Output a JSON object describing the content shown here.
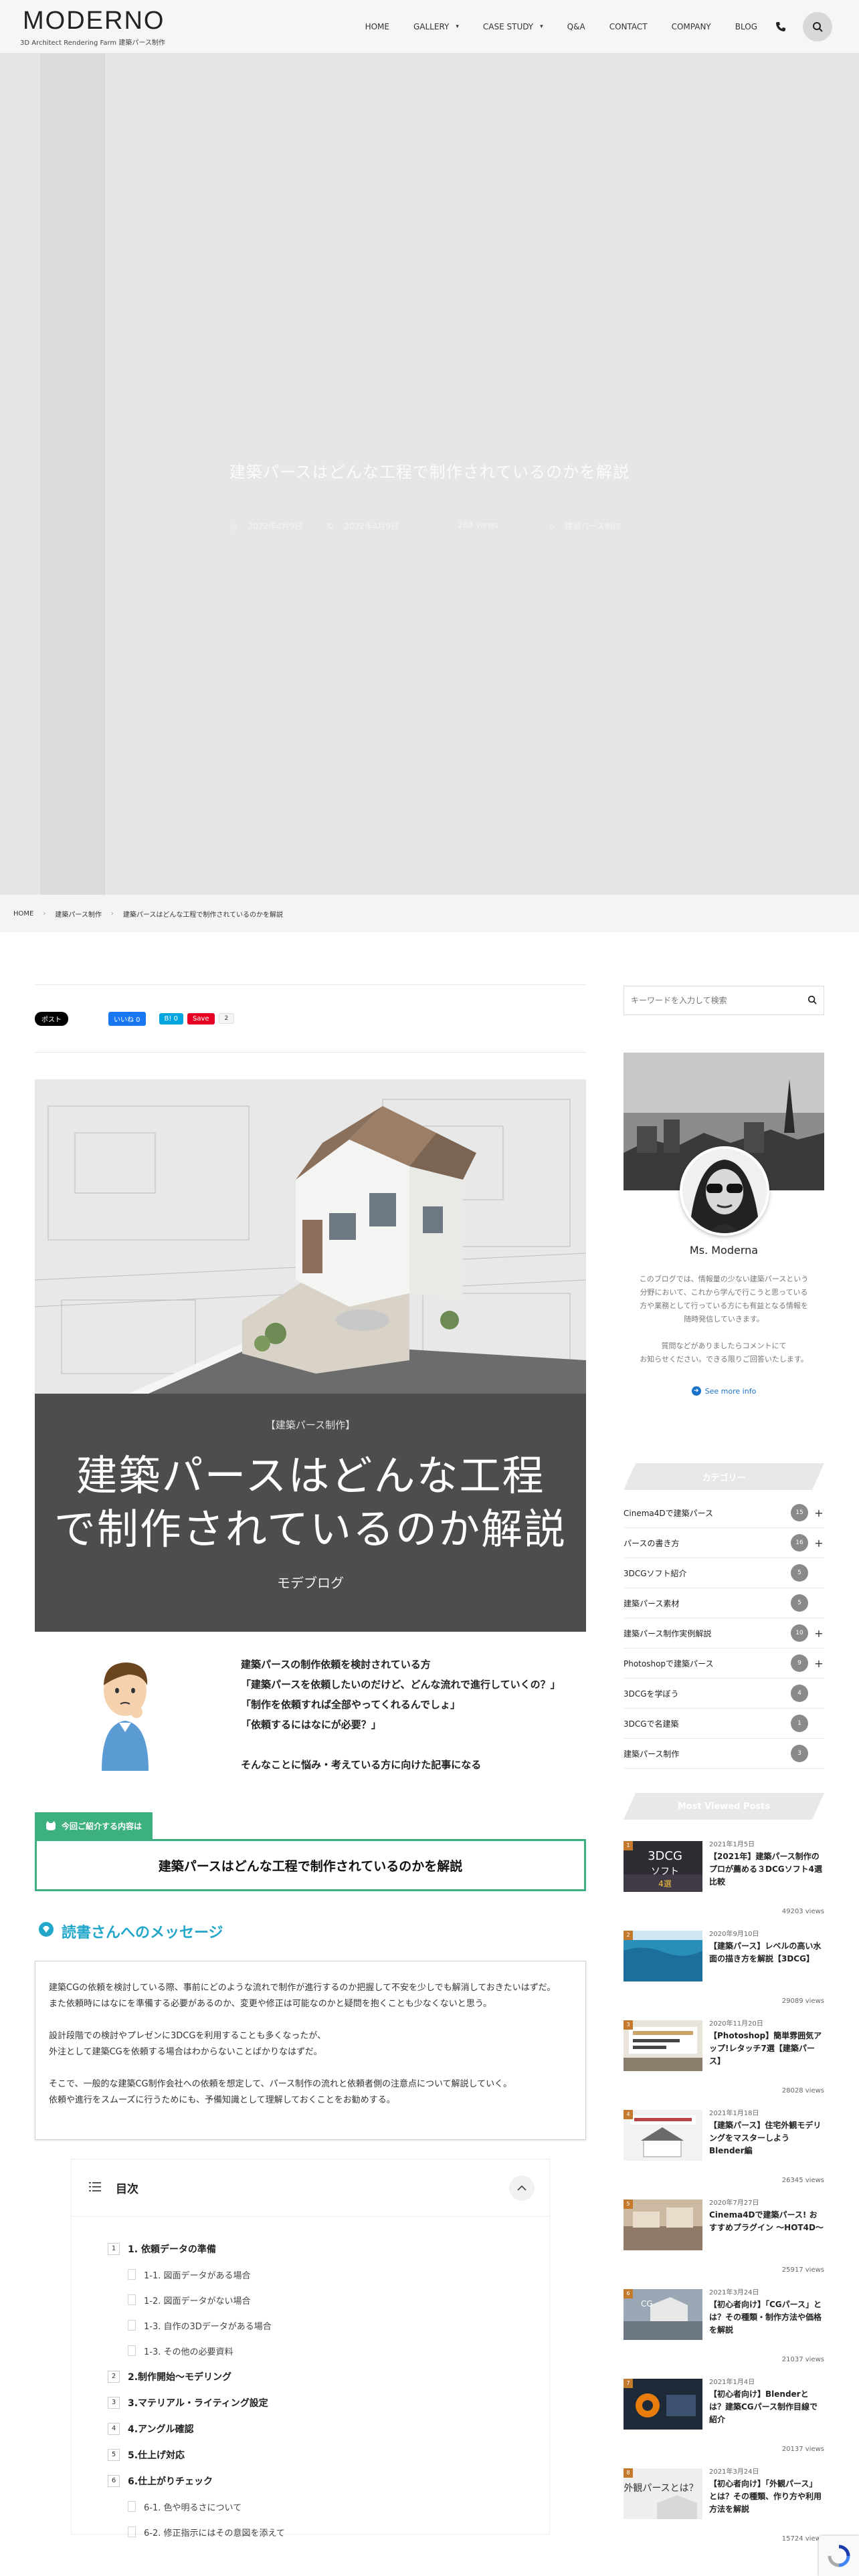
{
  "header": {
    "logo": "MODERNO",
    "logo_sub": "3D Architect Rendering Farm 建築パース制作",
    "nav": [
      {
        "label": "HOME",
        "caret": false
      },
      {
        "label": "GALLERY",
        "caret": true
      },
      {
        "label": "CASE STUDY",
        "caret": true
      },
      {
        "label": "Q&A",
        "caret": false
      },
      {
        "label": "CONTACT",
        "caret": false
      },
      {
        "label": "COMPANY",
        "caret": false
      },
      {
        "label": "BLOG",
        "caret": false
      }
    ]
  },
  "hero": {
    "title": "建築パースはどんな工程で制作されているのかを解説",
    "published": "2022年4月9日",
    "updated": "2022年4月9日",
    "views": "288 views",
    "category": "建築パース制作"
  },
  "breadcrumb": [
    "HOME",
    "建築パース制作",
    "建築パースはどんな工程で制作されているのかを解説"
  ],
  "share": {
    "x_label": "ポスト",
    "like_label": "いいね 0",
    "hatena_label": "B! 0",
    "pin_label": "Save",
    "pin_count": "2"
  },
  "eyecatch": {
    "category": "【建築パース制作】",
    "title_line1": "建築パースはどんな工程",
    "title_line2": "で制作されているのか解説",
    "author": "モデブログ"
  },
  "intro": {
    "lines": [
      "建築パースの制作依頼を検討されている方",
      "「建築パースを依頼したいのだけど、どんな流れで進行していくの？」",
      "「制作を依頼すれば全部やってくれるんでしょ」",
      "「依頼するにはなにが必要？」",
      "",
      "そんなことに悩み・考えている方に向けた記事になる"
    ]
  },
  "toc_box": {
    "label": "今回ご紹介する内容は",
    "content": "建築パースはどんな工程で制作されているのかを解説"
  },
  "message": {
    "heading": "読書さんへのメッセージ",
    "p1a": "建築CGの依頼を検討している際、事前にどのような流れで制作が進行するのか把握して不安を少しでも解消しておきたいはずだ。",
    "p1b": "また依頼時にはなにを準備する必要があるのか、変更や修正は可能なのかと疑問を抱くことも少なくないと思う。",
    "p2a": "設計段階での検討やプレゼンに3DCGを利用することも多くなったが、",
    "p2b": "外注として建築CGを依頼する場合はわからないことばかりなはずだ。",
    "p3a": "そこで、一般的な建築CG制作会社への依頼を想定して、パース制作の流れと依頼者側の注意点について解説していく。",
    "p3b": "依頼や進行をスムーズに行うためにも、予備知識として理解しておくことをお勧めする。"
  },
  "mokuji": {
    "title": "目次",
    "items": [
      {
        "num": "1",
        "label": "1. 依頼データの準備"
      },
      {
        "sub": "1-1. 図面データがある場合"
      },
      {
        "sub": "1-2. 図面データがない場合"
      },
      {
        "sub": "1-3. 自作の3Dデータがある場合"
      },
      {
        "sub": "1-3. その他の必要資料"
      },
      {
        "num": "2",
        "label": "2.制作開始〜モデリング"
      },
      {
        "num": "3",
        "label": "3.マテリアル・ライティング設定"
      },
      {
        "num": "4",
        "label": "4.アングル確認"
      },
      {
        "num": "5",
        "label": "5.仕上げ対応"
      },
      {
        "num": "6",
        "label": "6.仕上がりチェック"
      },
      {
        "sub": "6-1. 色や明るさについて"
      },
      {
        "sub": "6-2. 修正指示にはその意図を添えて"
      }
    ]
  },
  "sidebar": {
    "search_placeholder": "キーワードを入力して検索",
    "profile": {
      "name": "Ms. Moderna",
      "bio": [
        "このブログでは、情報量の少ない建築パースという",
        "分野において、これから学んで行こうと思っている",
        "方や業務として行っている方にも有益となる情報を",
        "随時発信していきます。"
      ],
      "bio2": [
        "質問などがありましたらコメントにて",
        "お知らせください。できる限りご回答いたします。"
      ],
      "see_more": "See more info"
    },
    "category_title": "カテゴリー",
    "categories": [
      {
        "name": "Cinema4Dで建築パース",
        "count": "15",
        "plus": true
      },
      {
        "name": "パースの書き方",
        "count": "16",
        "plus": true
      },
      {
        "name": "3DCGソフト紹介",
        "count": "5",
        "plus": false
      },
      {
        "name": "建築パース素材",
        "count": "5",
        "plus": false
      },
      {
        "name": "建築パース制作実例解説",
        "count": "10",
        "plus": true
      },
      {
        "name": "Photoshopで建築パース",
        "count": "9",
        "plus": true
      },
      {
        "name": "3DCGを学ぼう",
        "count": "4",
        "plus": false
      },
      {
        "name": "3DCGで名建築",
        "count": "1",
        "plus": false
      },
      {
        "name": "建築パース制作",
        "count": "3",
        "plus": false
      }
    ],
    "popular_title": "Most Viewed Posts",
    "popular": [
      {
        "rank": "1",
        "date": "2021年1月5日",
        "title": "【2021年】建築パース制作のプロが薦める３DCGソフト4選比較",
        "views": "49203 views",
        "thumb_text": "3DCG\nソフト\n4選"
      },
      {
        "rank": "2",
        "date": "2020年9月10日",
        "title": "【建築パース】レベルの高い水面の描き方を解説【3DCG】",
        "views": "29089 views",
        "thumb_text": ""
      },
      {
        "rank": "3",
        "date": "2020年11月20日",
        "title": "【Photoshop】簡単雰囲気アップ!レタッチ7選【建築パース】",
        "views": "28028 views",
        "thumb_text": ""
      },
      {
        "rank": "4",
        "date": "2021年1月18日",
        "title": "【建築パース】住宅外観モデリングをマスターしようBlender編",
        "views": "26345 views",
        "thumb_text": ""
      },
      {
        "rank": "5",
        "date": "2020年7月27日",
        "title": "Cinema4Dで建築パース! おすすめプラグイン 〜HOT4D〜",
        "views": "25917 views",
        "thumb_text": ""
      },
      {
        "rank": "6",
        "date": "2021年3月24日",
        "title": "【初心者向け】「CGパース」とは？その種類・制作方法や価格を解説",
        "views": "21037 views",
        "thumb_text": ""
      },
      {
        "rank": "7",
        "date": "2021年1月4日",
        "title": "【初心者向け】Blenderとは？建築CGパース制作目線で紹介",
        "views": "20137 views",
        "thumb_text": ""
      },
      {
        "rank": "8",
        "date": "2021年3月24日",
        "title": "【初心者向け】「外観パース」とは？その種類、作り方や利用方法を解説",
        "views": "15724 views",
        "thumb_text": "外観パースとは？"
      }
    ]
  },
  "colors": {
    "accent_green": "#3db07f",
    "accent_blue": "#22a6c9",
    "panel_dark": "#4d4d4d"
  }
}
